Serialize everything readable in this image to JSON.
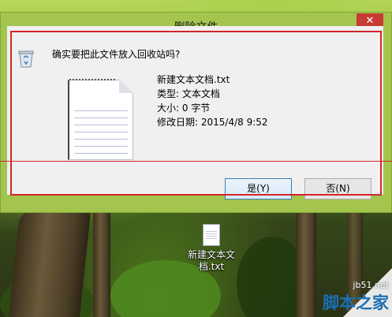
{
  "window": {
    "title": "删除文件",
    "close_label": "✕"
  },
  "dialog": {
    "question": "确实要把此文件放入回收站吗?",
    "file": {
      "name": "新建文本文档.txt",
      "type": "类型: 文本文档",
      "size": "大小: 0 字节",
      "modified": "修改日期: 2015/4/8 9:52"
    },
    "buttons": {
      "yes": "是(Y)",
      "no": "否(N)"
    }
  },
  "desktop": {
    "file_icon_label_line1": "新建文本文",
    "file_icon_label_line2": "档.txt"
  },
  "watermark": {
    "site": "jb51.net",
    "brand": "脚本之家"
  },
  "colors": {
    "title_bar": "#a3c54e",
    "close_button": "#c73b32",
    "highlight_border": "#d4262b",
    "dialog_body": "#f0f0f0"
  }
}
